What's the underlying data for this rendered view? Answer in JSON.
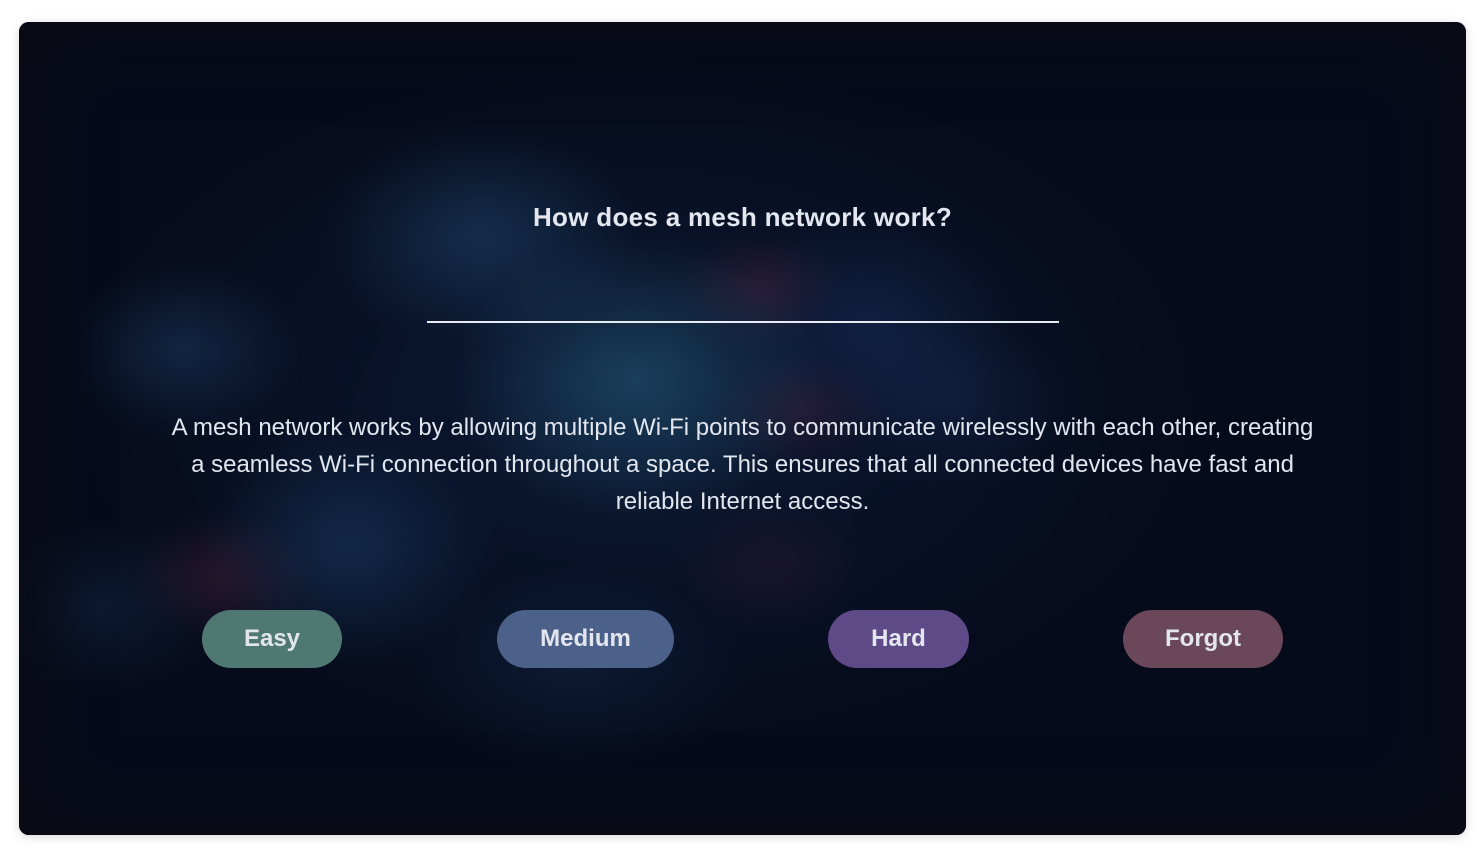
{
  "card": {
    "question": "How does a mesh network work?",
    "answer": "A mesh network works by allowing multiple Wi-Fi points to communicate wirelessly with each other, creating a seamless Wi-Fi connection throughout a space. This ensures that all connected devices have fast and reliable Internet access."
  },
  "buttons": {
    "easy": {
      "label": "Easy",
      "color": "#4f7873"
    },
    "medium": {
      "label": "Medium",
      "color": "#4c6189"
    },
    "hard": {
      "label": "Hard",
      "color": "#5d4a86"
    },
    "forgot": {
      "label": "Forgot",
      "color": "#6b4859"
    }
  },
  "colors": {
    "background": "#070c1c",
    "text": "#e4e7ef",
    "divider": "#e8ebf2"
  }
}
